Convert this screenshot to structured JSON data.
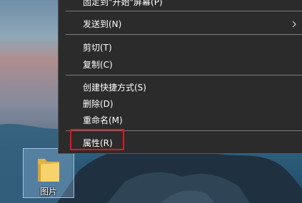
{
  "desktop": {
    "icon_label": "图片"
  },
  "context_menu": {
    "items": [
      {
        "label": "固定到\"开始\"屏幕(P)"
      },
      {
        "label": "发送到(N)",
        "has_submenu": true
      },
      {
        "label": "剪切(T)"
      },
      {
        "label": "复制(C)"
      },
      {
        "label": "创建快捷方式(S)"
      },
      {
        "label": "删除(D)"
      },
      {
        "label": "重命名(M)"
      },
      {
        "label": "属性(R)"
      }
    ]
  },
  "colors": {
    "menu_background": "#2b2b2b",
    "menu_text": "#ffffff",
    "highlight_border": "#e8141a"
  },
  "icons": {
    "submenu": "chevron-right-icon",
    "folder": "folder-icon"
  }
}
